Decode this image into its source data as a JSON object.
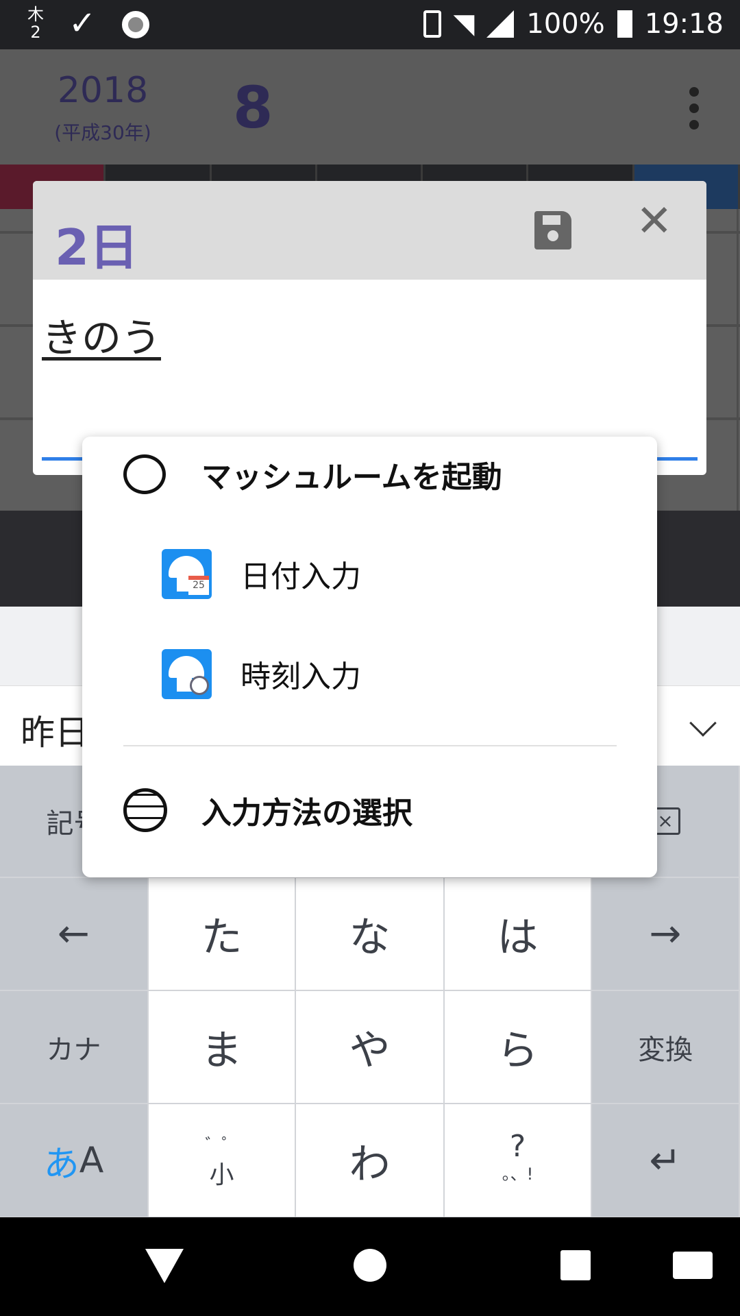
{
  "status_bar": {
    "left_icons": [
      "calendar-day-icon",
      "check-icon",
      "record-icon"
    ],
    "calendar_day": "木\n2",
    "battery": "100%",
    "time": "19:18",
    "right_icons": [
      "vibrate-icon",
      "wifi-icon",
      "signal-icon",
      "battery-charging-icon"
    ]
  },
  "header": {
    "year": "2018",
    "era": "(平成30年)",
    "month": "8"
  },
  "dialog": {
    "title": "2日",
    "text": "きのう",
    "icons": [
      "save-icon",
      "close-icon"
    ]
  },
  "suggestion": {
    "word": "昨日"
  },
  "menu": {
    "items": [
      {
        "label": "マッシュルームを起動",
        "icon": "speech-bubble-icon"
      },
      {
        "label": "日付入力",
        "icon": "mushroom-calendar-icon",
        "badge": "25"
      },
      {
        "label": "時刻入力",
        "icon": "mushroom-clock-icon"
      },
      {
        "label": "入力方法の選択",
        "icon": "globe-icon"
      }
    ]
  },
  "keyboard": {
    "symbols": "記号",
    "left": "←",
    "right": "→",
    "ta": "た",
    "na": "な",
    "ha": "は",
    "kana": "カナ",
    "ma": "ま",
    "ya": "や",
    "ra": "ら",
    "henkan": "変換",
    "mode_a": "あ",
    "mode_b": "A",
    "dakuten": "゛゜",
    "small": "小",
    "wa": "わ",
    "punct": "?",
    "punct2": "。、!",
    "enter": "↵"
  },
  "colors": {
    "accent": "#2f7fe8",
    "title": "#6a60b2",
    "keyboard_mode": "#2196f3"
  }
}
